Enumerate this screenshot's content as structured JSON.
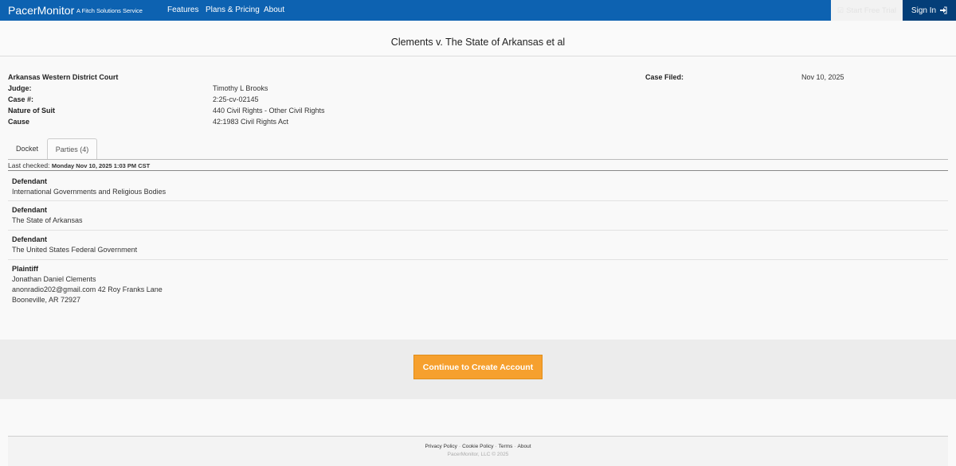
{
  "nav": {
    "brand": "PacerMonitor",
    "tagline": "A Fitch Solutions Service",
    "links": [
      "Features",
      "Plans & Pricing",
      "About"
    ],
    "trial_label": "Start Free Trial",
    "signin_label": "Sign In",
    "trial_icon": "checkbox-icon",
    "signin_icon": "login-arrow-icon",
    "colors": {
      "bar": "#0d62b1",
      "signin": "#043e78",
      "cta": "#f6a02e"
    }
  },
  "case": {
    "title": "Clements v. The State of Arkansas et al",
    "court": "Arkansas Western District Court",
    "fields": [
      {
        "label": "Judge:",
        "value": "Timothy L Brooks"
      },
      {
        "label": "Case #:",
        "value": "2:25-cv-02145"
      },
      {
        "label": "Nature of Suit",
        "value": "440 Civil Rights - Other Civil Rights"
      },
      {
        "label": "Cause",
        "value": "42:1983 Civil Rights Act"
      }
    ],
    "filed_label": "Case Filed:",
    "filed_value": "Nov 10, 2025"
  },
  "tabs": [
    {
      "label": "Docket"
    },
    {
      "label": "Parties (4)"
    }
  ],
  "last_checked": {
    "label": "Last checked:",
    "value": "Monday Nov 10, 2025 1:03 PM CST"
  },
  "parties": [
    {
      "role": "Defendant",
      "lines": [
        "International Governments and Religious Bodies"
      ]
    },
    {
      "role": "Defendant",
      "lines": [
        "The State of Arkansas"
      ]
    },
    {
      "role": "Defendant",
      "lines": [
        "The United States Federal Government"
      ]
    },
    {
      "role": "Plaintiff",
      "lines": [
        "Jonathan Daniel Clements",
        "anonradio202@gmail.com 42 Roy Franks Lane",
        "Booneville, AR 72927"
      ]
    }
  ],
  "cta": {
    "label": "Continue to Create Account"
  },
  "footer": {
    "links": [
      "Privacy Policy",
      "Cookie Policy",
      "Terms",
      "About"
    ],
    "copyright": "PacerMonitor, LLC © 2025"
  }
}
